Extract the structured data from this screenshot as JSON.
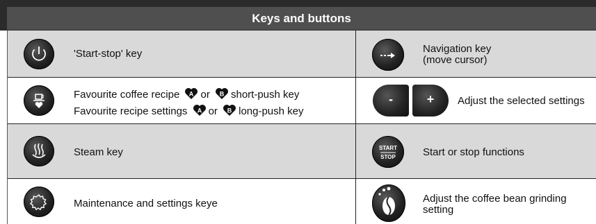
{
  "header": {
    "title": "Keys and buttons"
  },
  "rows": [
    {
      "left_label": "'Start-stop' key",
      "right_label_1": "Navigation key",
      "right_label_2": "(move cursor)"
    },
    {
      "left_label_1a": "Favourite coffee recipe",
      "left_label_1b": "or",
      "left_label_1c": "short-push key",
      "left_label_2a": "Favourite recipe settings",
      "left_label_2b": "or",
      "left_label_2c": "long-push key",
      "badge_a": "A",
      "badge_b": "B",
      "minus": "-",
      "plus": "+",
      "right_label": "Adjust the selected settings"
    },
    {
      "left_label": "Steam key",
      "start": "START",
      "stop": "STOP",
      "right_label": "Start or stop functions"
    },
    {
      "left_label": "Maintenance and settings keye",
      "right_label_1": "Adjust the coffee bean grinding",
      "right_label_2": "setting"
    }
  ],
  "icons": [
    "power-icon",
    "favourite-coffee-icon",
    "steam-icon",
    "gear-icon",
    "navigation-arrow-icon",
    "minus-button",
    "plus-button",
    "start-stop-icon",
    "coffee-bean-icon"
  ]
}
